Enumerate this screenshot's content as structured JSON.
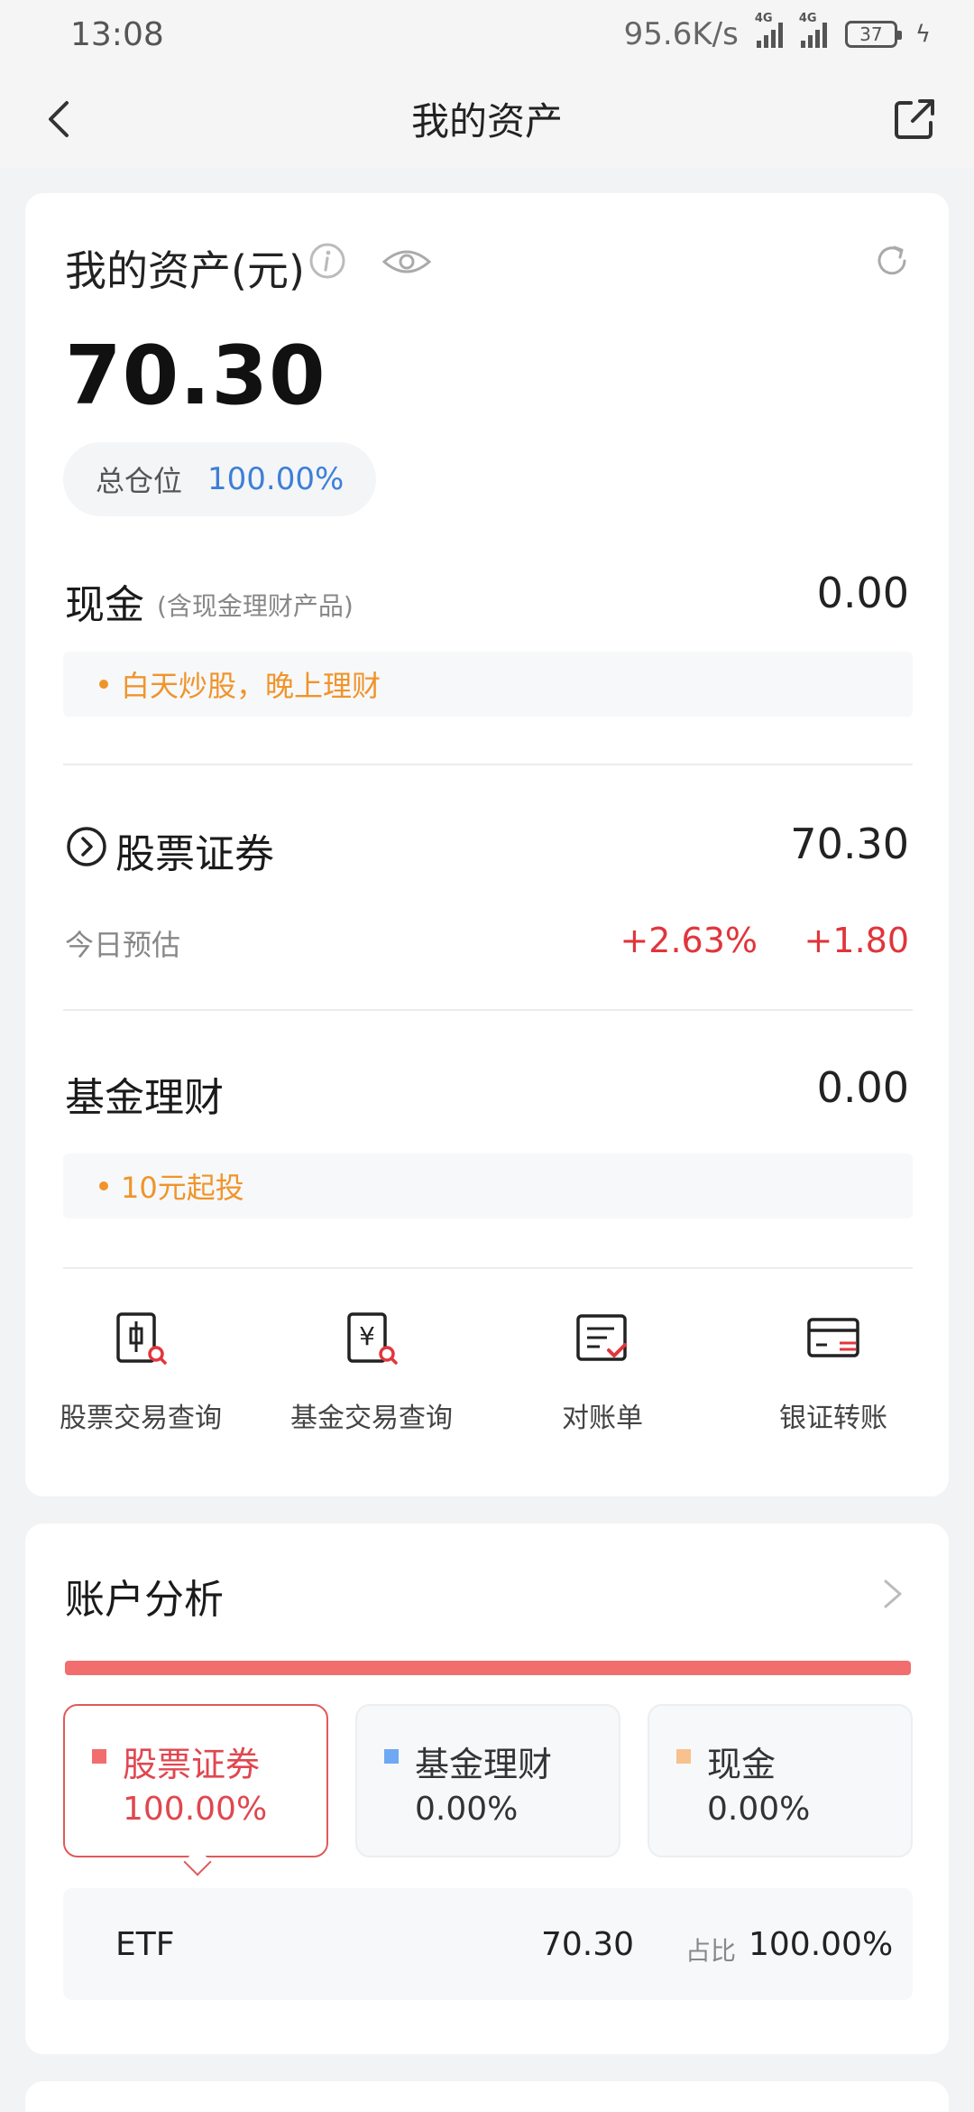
{
  "status_bar": {
    "time": "13:08",
    "net_speed": "95.6K/s",
    "signal1_tag": "4G",
    "signal2_tag": "4G",
    "battery": "37"
  },
  "nav": {
    "title": "我的资产",
    "back_icon": "chevron-left-icon",
    "share_icon": "external-share-icon"
  },
  "assets": {
    "title": "我的资产(元)",
    "total": "70.30",
    "position_label": "总仓位",
    "position_value": "100.00%",
    "cash": {
      "title": "现金",
      "subtitle": "(含现金理财产品)",
      "value": "0.00",
      "tip": "白天炒股，晚上理财"
    },
    "stock": {
      "title": "股票证券",
      "value": "70.30",
      "today_label": "今日预估",
      "today_pct": "+2.63%",
      "today_amount": "+1.80"
    },
    "fund": {
      "title": "基金理财",
      "value": "0.00",
      "tip": "10元起投"
    },
    "shortcuts": [
      {
        "label": "股票交易查询",
        "icon": "stock-query-icon"
      },
      {
        "label": "基金交易查询",
        "icon": "fund-query-icon"
      },
      {
        "label": "对账单",
        "icon": "statement-icon"
      },
      {
        "label": "银证转账",
        "icon": "bank-transfer-icon"
      }
    ]
  },
  "analysis": {
    "title": "账户分析",
    "accent": "#f46d6d",
    "segments": [
      {
        "name": "股票证券",
        "pct": "100.00%",
        "color": "#f26d6d",
        "share": 1.0,
        "selected": true
      },
      {
        "name": "基金理财",
        "pct": "0.00%",
        "color": "#6fa8f3",
        "share": 0.0,
        "selected": false
      },
      {
        "name": "现金",
        "pct": "0.00%",
        "color": "#f9c18d",
        "share": 0.0,
        "selected": false
      }
    ],
    "detail": {
      "name": "ETF",
      "value": "70.30",
      "ratio_label": "占比",
      "ratio": "100.00%"
    }
  }
}
